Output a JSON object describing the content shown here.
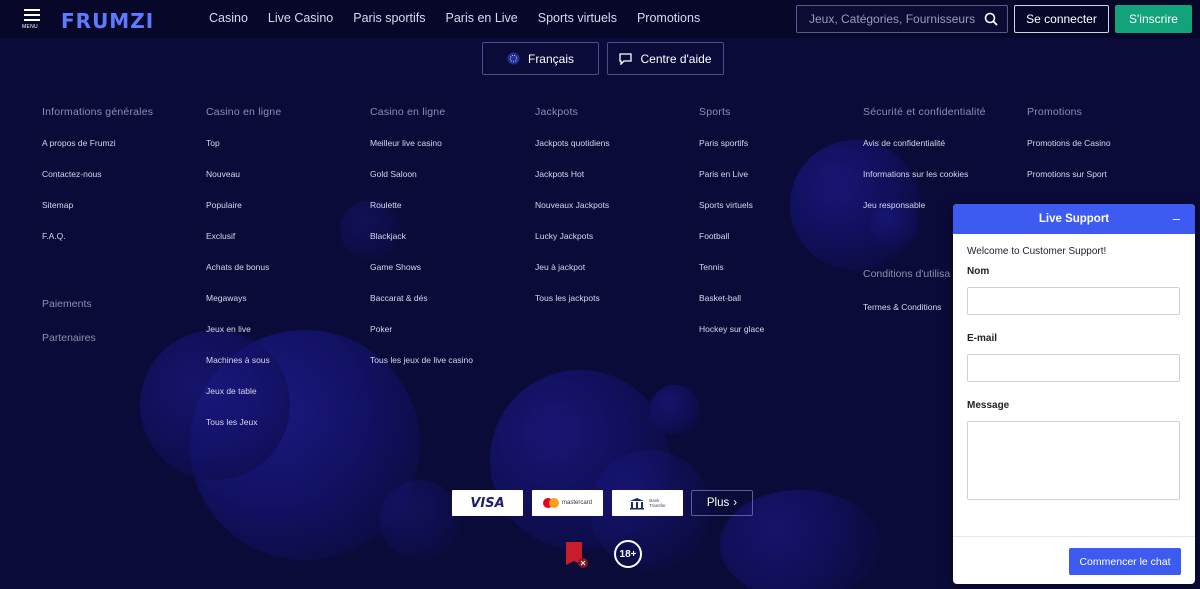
{
  "header": {
    "menu_label": "MENU",
    "logo_text": "FRUMZI",
    "nav": [
      "Casino",
      "Live Casino",
      "Paris sportifs",
      "Paris en Live",
      "Sports virtuels",
      "Promotions"
    ],
    "search_placeholder": "Jeux, Catégories, Fournisseurs",
    "login": "Se connecter",
    "signup": "S'inscrire"
  },
  "top_buttons": {
    "language": "Français",
    "help": "Centre d'aide"
  },
  "columns": [
    {
      "title": "Informations générales",
      "items": [
        "A propos de Frumzi",
        "Contactez-nous",
        "Sitemap",
        "F.A.Q."
      ]
    },
    {
      "title": "Casino en ligne",
      "items": [
        "Top",
        "Nouveau",
        "Populaire",
        "Exclusif",
        "Achats de bonus",
        "Megaways",
        "Jeux en live",
        "Machines à sous",
        "Jeux de table",
        "Tous les Jeux"
      ]
    },
    {
      "title": "Casino en ligne",
      "items": [
        "Meilleur live casino",
        "Gold Saloon",
        "Roulette",
        "Blackjack",
        "Game Shows",
        "Baccarat & dés",
        "Poker",
        "Tous les jeux de live casino"
      ]
    },
    {
      "title": "Jackpots",
      "items": [
        "Jackpots quotidiens",
        "Jackpots Hot",
        "Nouveaux Jackpots",
        "Lucky Jackpots",
        "Jeu à jackpot",
        "Tous les jackpots"
      ]
    },
    {
      "title": "Sports",
      "items": [
        "Paris sportifs",
        "Paris en Live",
        "Sports virtuels",
        "Football",
        "Tennis",
        "Basket-ball",
        "Hockey sur glace"
      ]
    },
    {
      "title": "Sécurité et confidentialité",
      "items": [
        "Avis de confidentialité",
        "Informations sur les cookies",
        "Jeu responsable"
      ]
    },
    {
      "title": "Promotions",
      "items": [
        "Promotions de Casino",
        "Promotions sur Sport"
      ]
    }
  ],
  "side_sections": {
    "payments": "Paiements",
    "partners": "Partenaires",
    "conditions": "Conditions d'utilisa",
    "terms": "Termes & Conditions"
  },
  "payments": {
    "visa": "VISA",
    "mastercard": "mastercard",
    "bank_line1": "Bank",
    "bank_line2": "Transfer",
    "more": "Plus"
  },
  "age_badge": "18+",
  "chat": {
    "title": "Live Support",
    "minimize": "–",
    "welcome": "Welcome to Customer Support!",
    "name_label": "Nom",
    "email_label": "E-mail",
    "message_label": "Message",
    "start_button": "Commencer le chat"
  },
  "colors": {
    "background": "#0b0b3a",
    "header": "#07072a",
    "signup": "#13a37a",
    "chat_accent": "#3d5af1"
  }
}
